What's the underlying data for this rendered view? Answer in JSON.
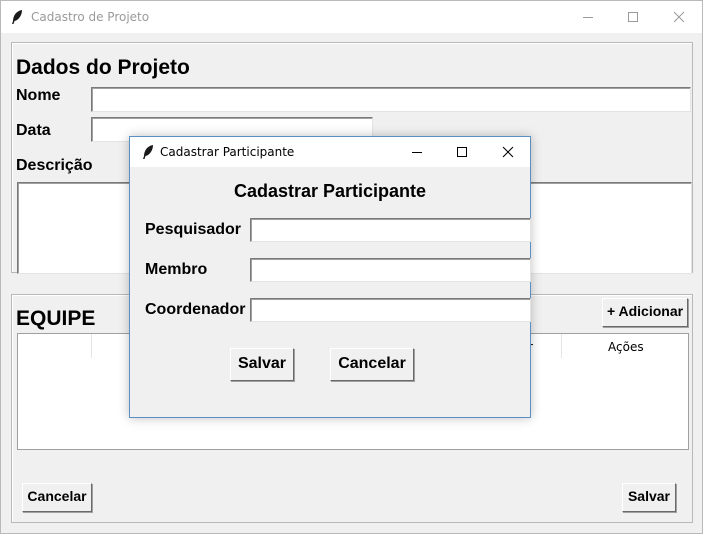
{
  "main_window": {
    "title": "Cadastro de Projeto",
    "heading": "Dados do Projeto",
    "fields": {
      "nome_label": "Nome",
      "nome_value": "",
      "data_label": "Data",
      "data_value": "",
      "descricao_label": "Descrição",
      "descricao_value": ""
    },
    "team": {
      "heading": "EQUIPE",
      "add_button": "+ Adicionar",
      "columns": [
        "",
        "",
        "",
        "r",
        "Ações"
      ]
    },
    "buttons": {
      "cancel": "Cancelar",
      "save": "Salvar"
    }
  },
  "dialog": {
    "title": "Cadastrar Participante",
    "heading": "Cadastrar Participante",
    "fields": {
      "pesquisador_label": "Pesquisador",
      "pesquisador_value": "",
      "membro_label": "Membro",
      "membro_value": "",
      "coordenador_label": "Coordenador",
      "coordenador_value": ""
    },
    "buttons": {
      "save": "Salvar",
      "cancel": "Cancelar"
    }
  },
  "icons": {
    "app": "feather-icon",
    "minimize": "minimize-icon",
    "maximize": "maximize-icon",
    "close": "close-icon"
  },
  "colors": {
    "window_bg": "#f0f0f0",
    "dialog_border": "#5a8fc2",
    "inactive_title": "#9a9a9a"
  }
}
